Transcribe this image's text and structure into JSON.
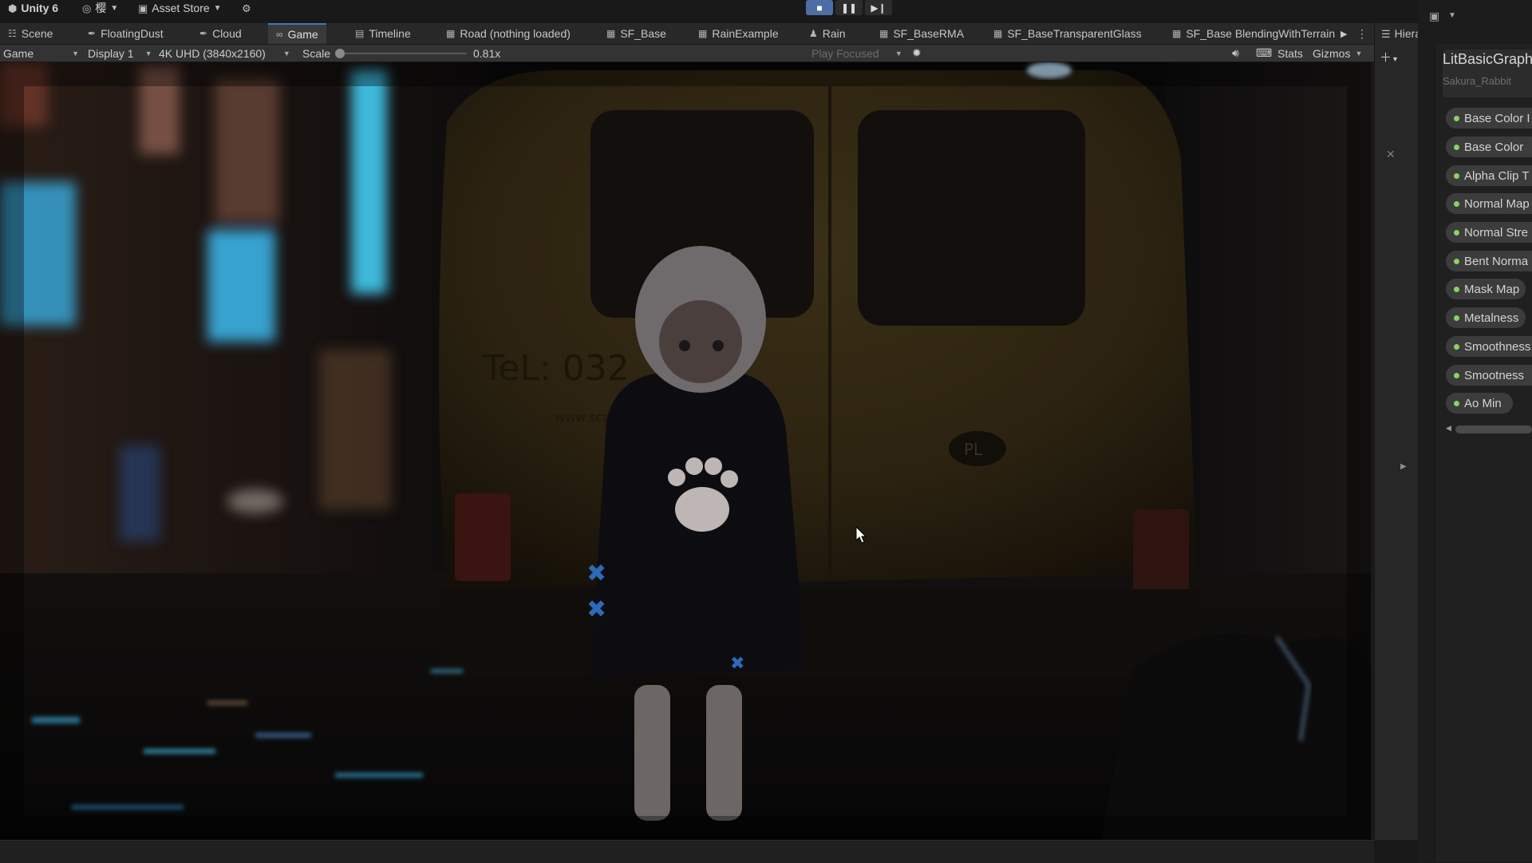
{
  "menubar": {
    "product": "Unity 6",
    "account_label": "樱",
    "asset_store": "Asset Store"
  },
  "tabs": [
    {
      "label": "Scene",
      "icon": "grid-icon"
    },
    {
      "label": "FloatingDust",
      "icon": "feather-icon"
    },
    {
      "label": "Cloud",
      "icon": "feather-icon"
    },
    {
      "label": "Game",
      "icon": "gamepad-icon",
      "active": true
    },
    {
      "label": "Timeline",
      "icon": "timeline-icon"
    },
    {
      "label": "Road (nothing loaded)",
      "icon": "document-icon"
    },
    {
      "label": "SF_Base",
      "icon": "document-icon"
    },
    {
      "label": "RainExample",
      "icon": "document-icon"
    },
    {
      "label": "Rain",
      "icon": "figure-icon"
    },
    {
      "label": "SF_BaseRMA",
      "icon": "document-icon"
    },
    {
      "label": "SF_BaseTransparentGlass",
      "icon": "document-icon"
    },
    {
      "label": "SF_Base BlendingWithTerrain",
      "icon": "document-icon"
    }
  ],
  "game_toolbar": {
    "view": "Game",
    "display": "Display 1",
    "resolution": "4K UHD (3840x2160)",
    "scale_label": "Scale",
    "scale_value": "0.81x",
    "play_mode": "Play Focused",
    "stats": "Stats",
    "gizmos": "Gizmos"
  },
  "hierarchy": {
    "tab_label": "Hiera"
  },
  "blackboard": {
    "title": "LitBasicGraph",
    "subtitle": "Sakura_Rabbit",
    "properties": [
      "Base Color I",
      "Base Color",
      "Alpha Clip T",
      "Normal Map",
      "Normal Stre",
      "Bent Norma",
      "Mask Map",
      "Metalness",
      "Smoothness",
      "Smootness",
      "Ao Min"
    ]
  },
  "scene": {
    "van_phone": "TeL: 032",
    "van_site": "www.sca",
    "plate_badge": "PL"
  },
  "colors": {
    "accent_blue": "#4c6ea5",
    "property_dot": "#8ad35d",
    "neon_cyan": "#46d6ff"
  }
}
